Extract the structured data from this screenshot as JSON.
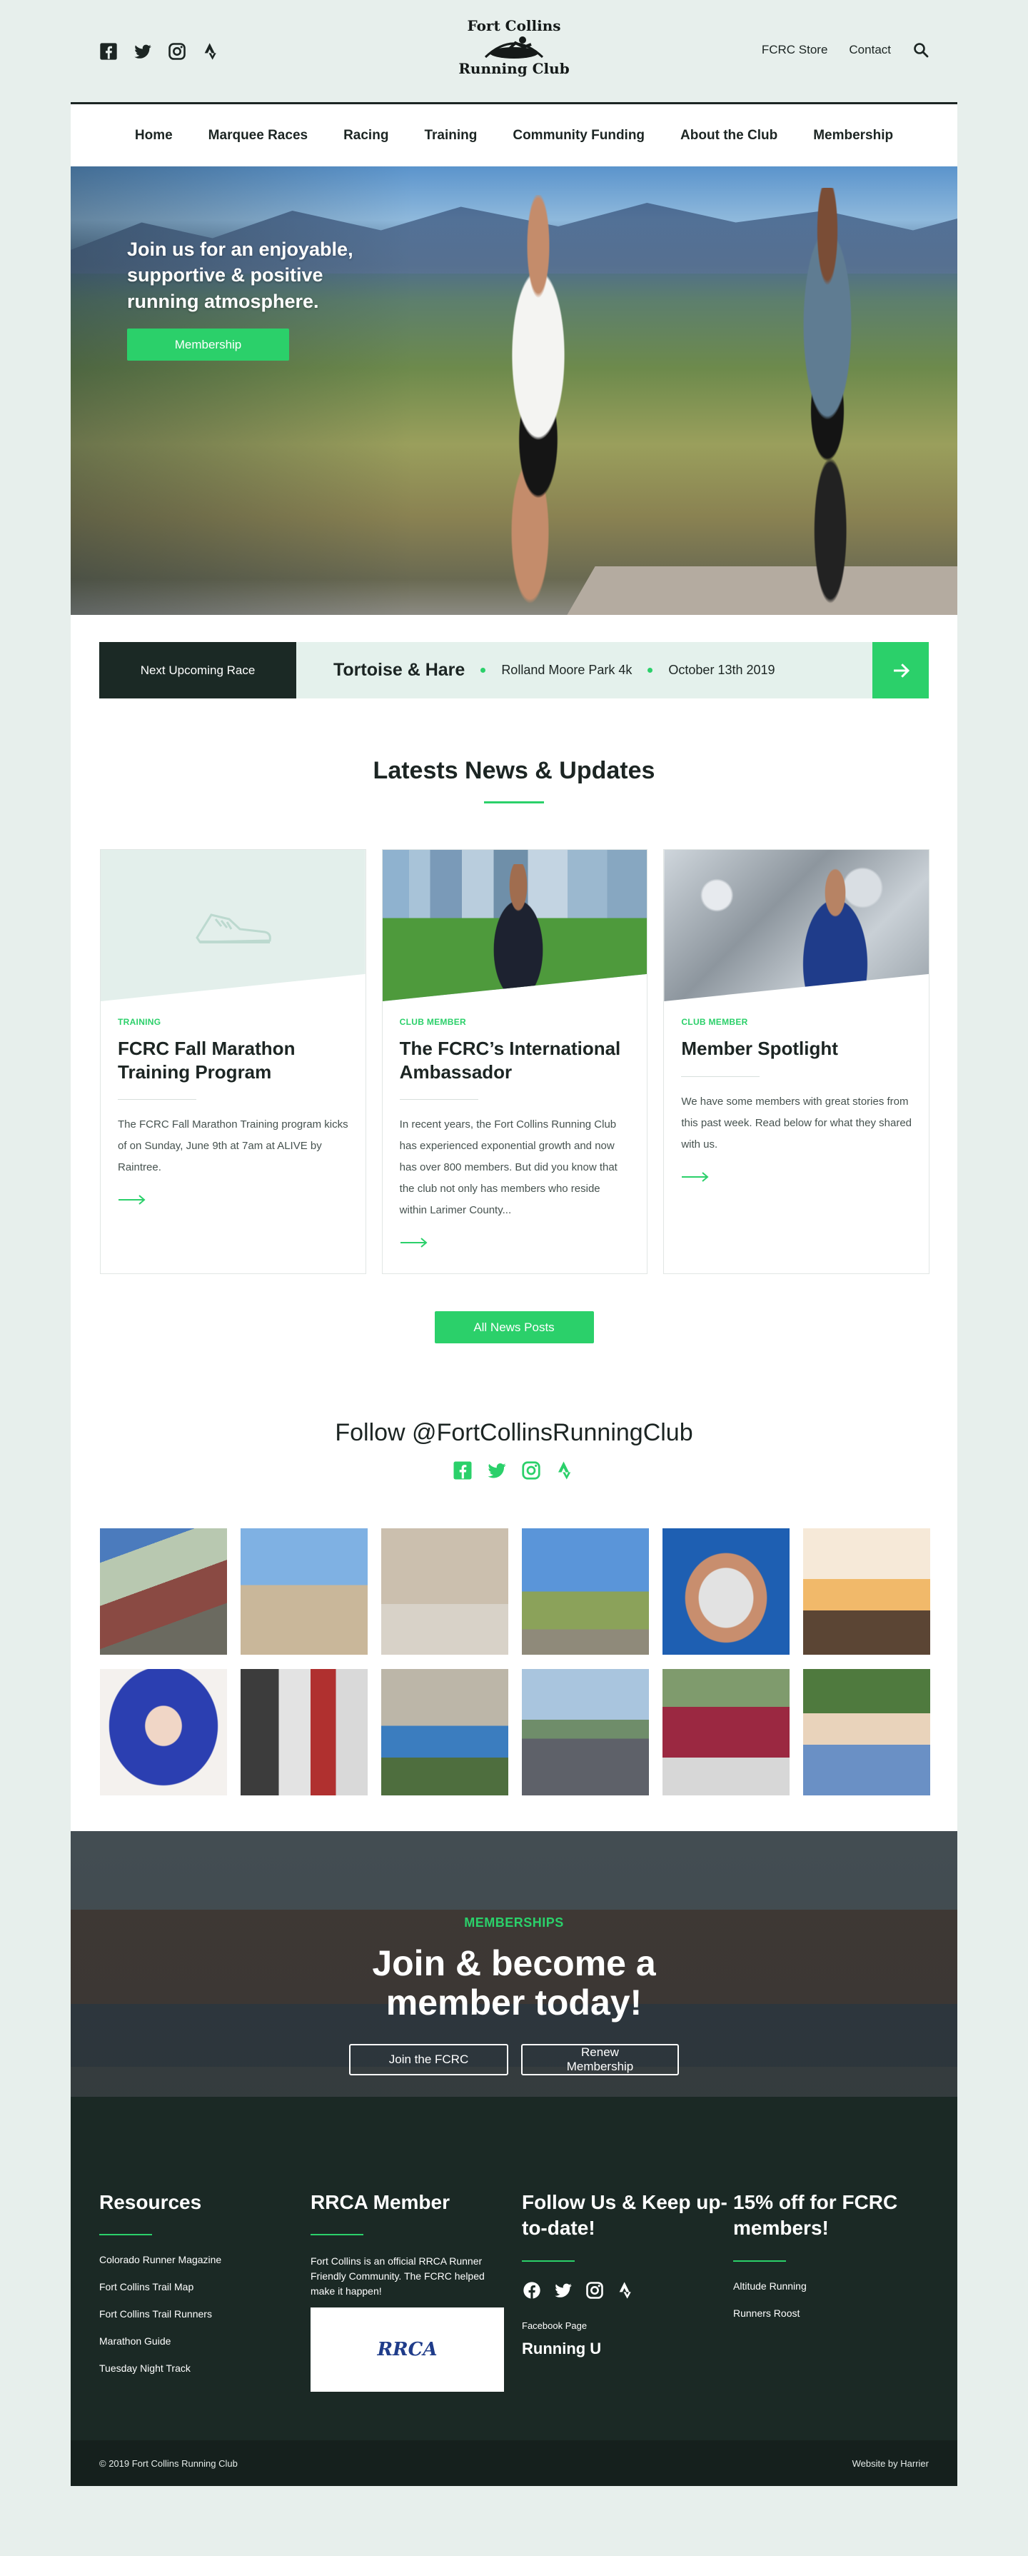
{
  "brand": {
    "logo_top": "Fort Collins",
    "logo_bottom": "Running Club",
    "accent": "#2bd06a",
    "dark": "#1b2925"
  },
  "top_social_icons": [
    "facebook-icon",
    "twitter-icon",
    "instagram-icon",
    "strava-icon"
  ],
  "top_links": {
    "store": "FCRC Store",
    "contact": "Contact",
    "search_icon": "search-icon"
  },
  "nav": {
    "items": [
      "Home",
      "Marquee Races",
      "Racing",
      "Training",
      "Community Funding",
      "About the Club",
      "Membership"
    ]
  },
  "hero": {
    "text": "Join us for an enjoyable, supportive & positive running atmosphere.",
    "button": "Membership"
  },
  "next_race": {
    "label": "Next Upcoming Race",
    "title": "Tortoise & Hare",
    "location": "Rolland Moore Park 4k",
    "date": "October 13th 2019",
    "arrow_icon": "arrow-right-icon"
  },
  "news": {
    "title": "Latests News & Updates",
    "cards": [
      {
        "category": "TRAINING",
        "title": "FCRC Fall Marathon Training Program",
        "text": "The FCRC Fall Marathon Training program kicks of on Sunday, June 9th at 7am at ALIVE by Raintree.",
        "image_icon": "running-shoe-icon"
      },
      {
        "category": "CLUB MEMBER",
        "title": "The FCRC’s International Ambassador",
        "text": "In recent years, the Fort Collins Running Club has experienced exponential growth and now has over 800 members. But did you know that the club not only has members who reside within Larimer County...",
        "image_icon": "photo"
      },
      {
        "category": "CLUB MEMBER",
        "title": "Member Spotlight",
        "text": "We have some members with great stories from this past week. Read below for what they shared with us.",
        "image_icon": "photo"
      }
    ],
    "all_button": "All News Posts"
  },
  "follow": {
    "title": "Follow @FortCollinsRunningClub",
    "icons": [
      "facebook-icon",
      "twitter-icon",
      "instagram-icon",
      "strava-icon"
    ]
  },
  "membership": {
    "kicker": "MEMBERSHIPS",
    "title_line1": "Join & become a",
    "title_line2": "member today!",
    "join_button": "Join the FCRC",
    "renew_button": "Renew Membership"
  },
  "footer": {
    "resources": {
      "title": "Resources",
      "links": [
        "Colorado Runner Magazine",
        "Fort Collins Trail Map",
        "Fort Collins Trail Runners",
        "Marathon Guide",
        "Tuesday Night Track"
      ]
    },
    "rrca": {
      "title": "RRCA Member",
      "text": "Fort Collins is an official RRCA Runner Friendly Community. The FCRC helped make it happen!",
      "logo_text": "RRCA"
    },
    "follow": {
      "title": "Follow Us & Keep up-to-date!",
      "icons": [
        "facebook-icon",
        "twitter-icon",
        "instagram-icon",
        "strava-icon"
      ],
      "fb_label": "Facebook Page",
      "running_u": "Running U"
    },
    "discount": {
      "title": "15% off for FCRC members!",
      "links": [
        "Altitude Running",
        "Runners Roost"
      ]
    },
    "copyright": "© 2019 Fort Collins Running Club",
    "credit": "Website by Harrier"
  }
}
